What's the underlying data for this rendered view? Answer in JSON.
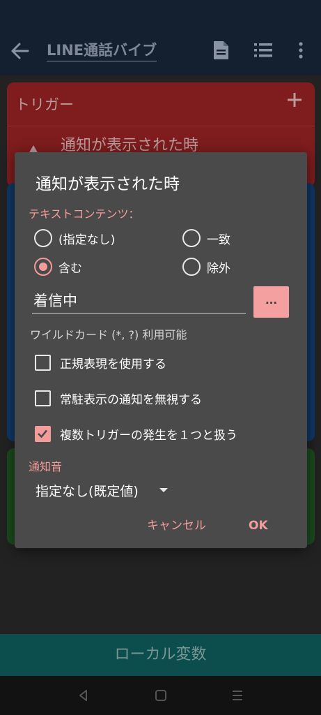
{
  "app_bar": {
    "title": "LINE通話バイブ",
    "back_icon": "arrow-left-icon",
    "document_icon": "document-icon",
    "list_icon": "list-icon",
    "more_icon": "more-vertical-icon",
    "background": "#142030"
  },
  "background_content": {
    "trigger_section": {
      "header": "トリガー",
      "add_icon": "plus-icon",
      "item_label": "通知が表示された時"
    },
    "local_variables_label": "ローカル変数"
  },
  "dialog": {
    "title": "通知が表示された時",
    "text_content_label": "テキストコンテンツ：",
    "match_options": [
      {
        "label": "(指定なし)",
        "selected": false
      },
      {
        "label": "一致",
        "selected": false
      },
      {
        "label": "含む",
        "selected": true
      },
      {
        "label": "除外",
        "selected": false
      }
    ],
    "text_value": "着信中",
    "dots_button_label": "...",
    "wildcard_hint": "ワイルドカード (*, ?) 利用可能",
    "checkboxes": [
      {
        "label": "正規表現を使用する",
        "checked": false
      },
      {
        "label": "常駐表示の通知を無視する",
        "checked": false
      },
      {
        "label": "複数トリガーの発生を１つと扱う",
        "checked": true
      }
    ],
    "sound_label": "通知音",
    "sound_value": "指定なし(既定値)",
    "cancel_label": "キャンセル",
    "ok_label": "OK",
    "accent_color": "#f39c9c"
  },
  "nav_bar": {
    "back_icon": "nav-back-icon",
    "home_icon": "nav-home-icon",
    "recents_icon": "nav-recents-icon"
  }
}
